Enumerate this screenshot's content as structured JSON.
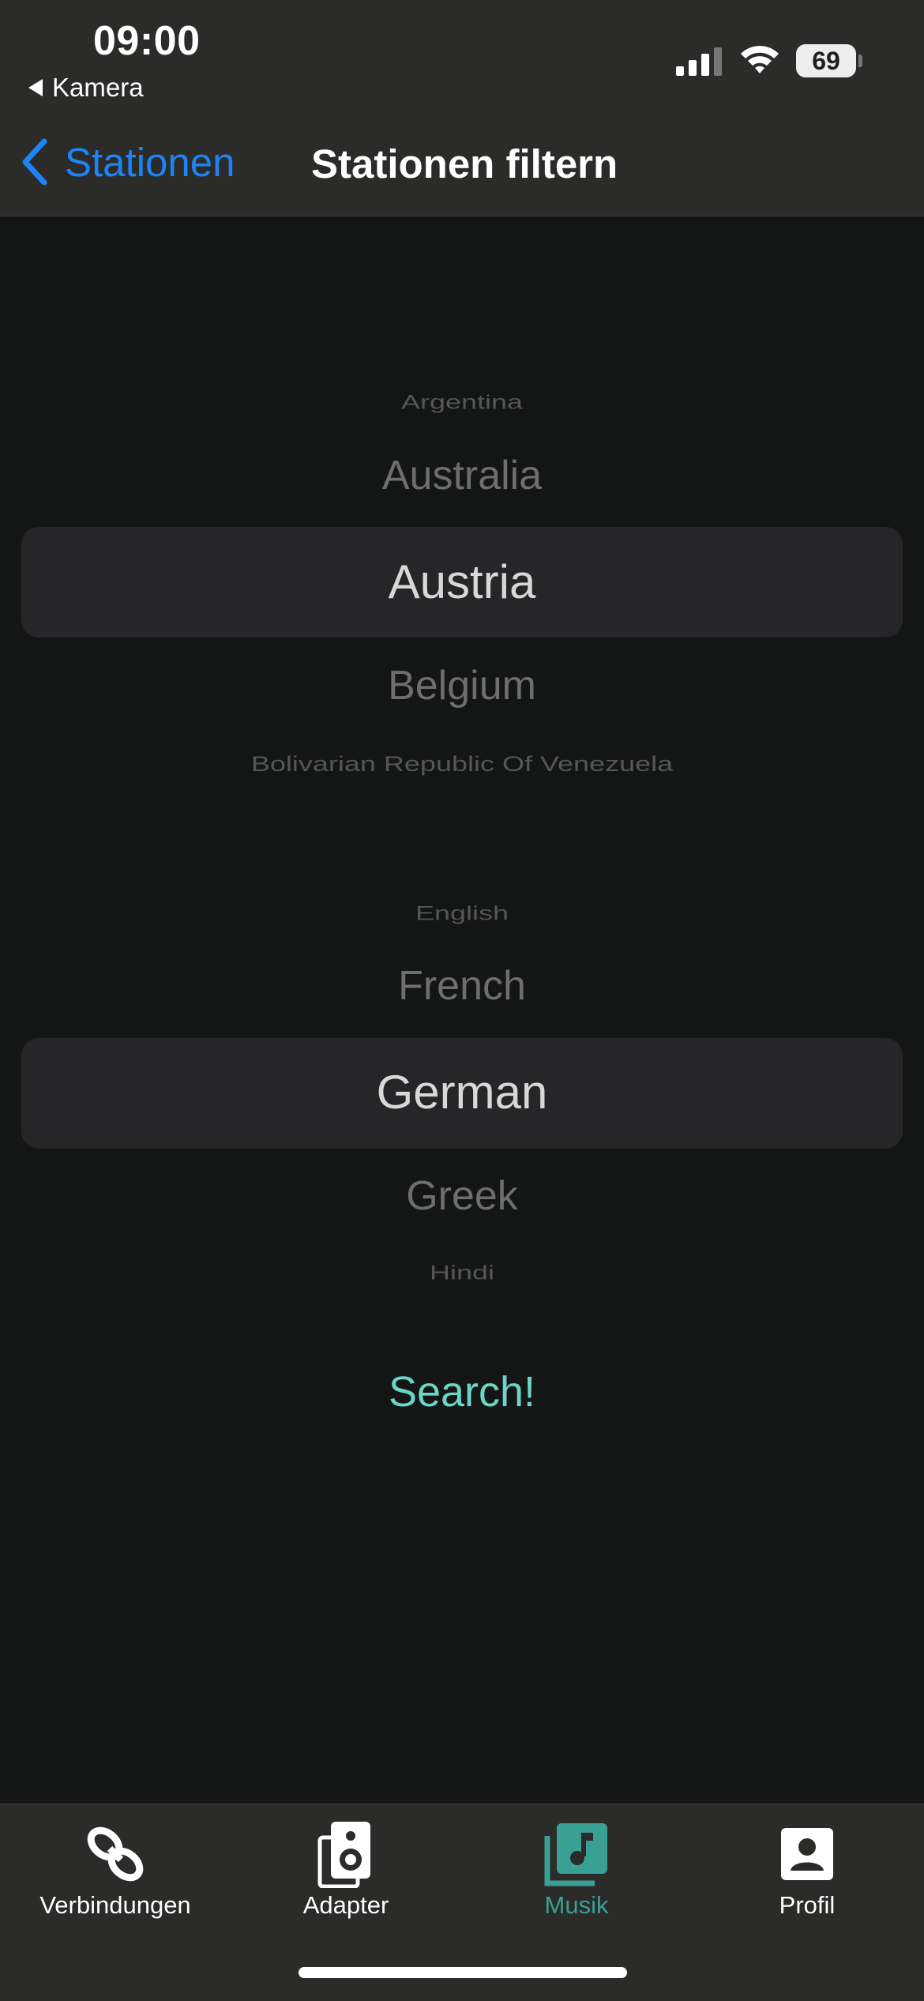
{
  "status": {
    "time": "09:00",
    "back_app": "Kamera",
    "battery": "69"
  },
  "nav": {
    "back_label": "Stationen",
    "title": "Stationen filtern"
  },
  "country_picker": {
    "items": [
      "Argentina",
      "Australia",
      "Austria",
      "Belgium",
      "Bolivarian Republic Of Venezuela"
    ],
    "selected": "Austria"
  },
  "language_picker": {
    "items": [
      "English",
      "French",
      "German",
      "Greek",
      "Hindi"
    ],
    "selected": "German"
  },
  "search_label": "Search!",
  "tabs": [
    {
      "label": "Verbindungen",
      "icon": "link-icon"
    },
    {
      "label": "Adapter",
      "icon": "speaker-icon"
    },
    {
      "label": "Musik",
      "icon": "music-library-icon",
      "active": true
    },
    {
      "label": "Profil",
      "icon": "profile-icon"
    }
  ],
  "colors": {
    "accent_blue": "#1e83f5",
    "accent_teal": "#6bd6c6",
    "active_tab": "#3aa096",
    "background": "#141515",
    "bar_background": "#2b2b2a"
  }
}
